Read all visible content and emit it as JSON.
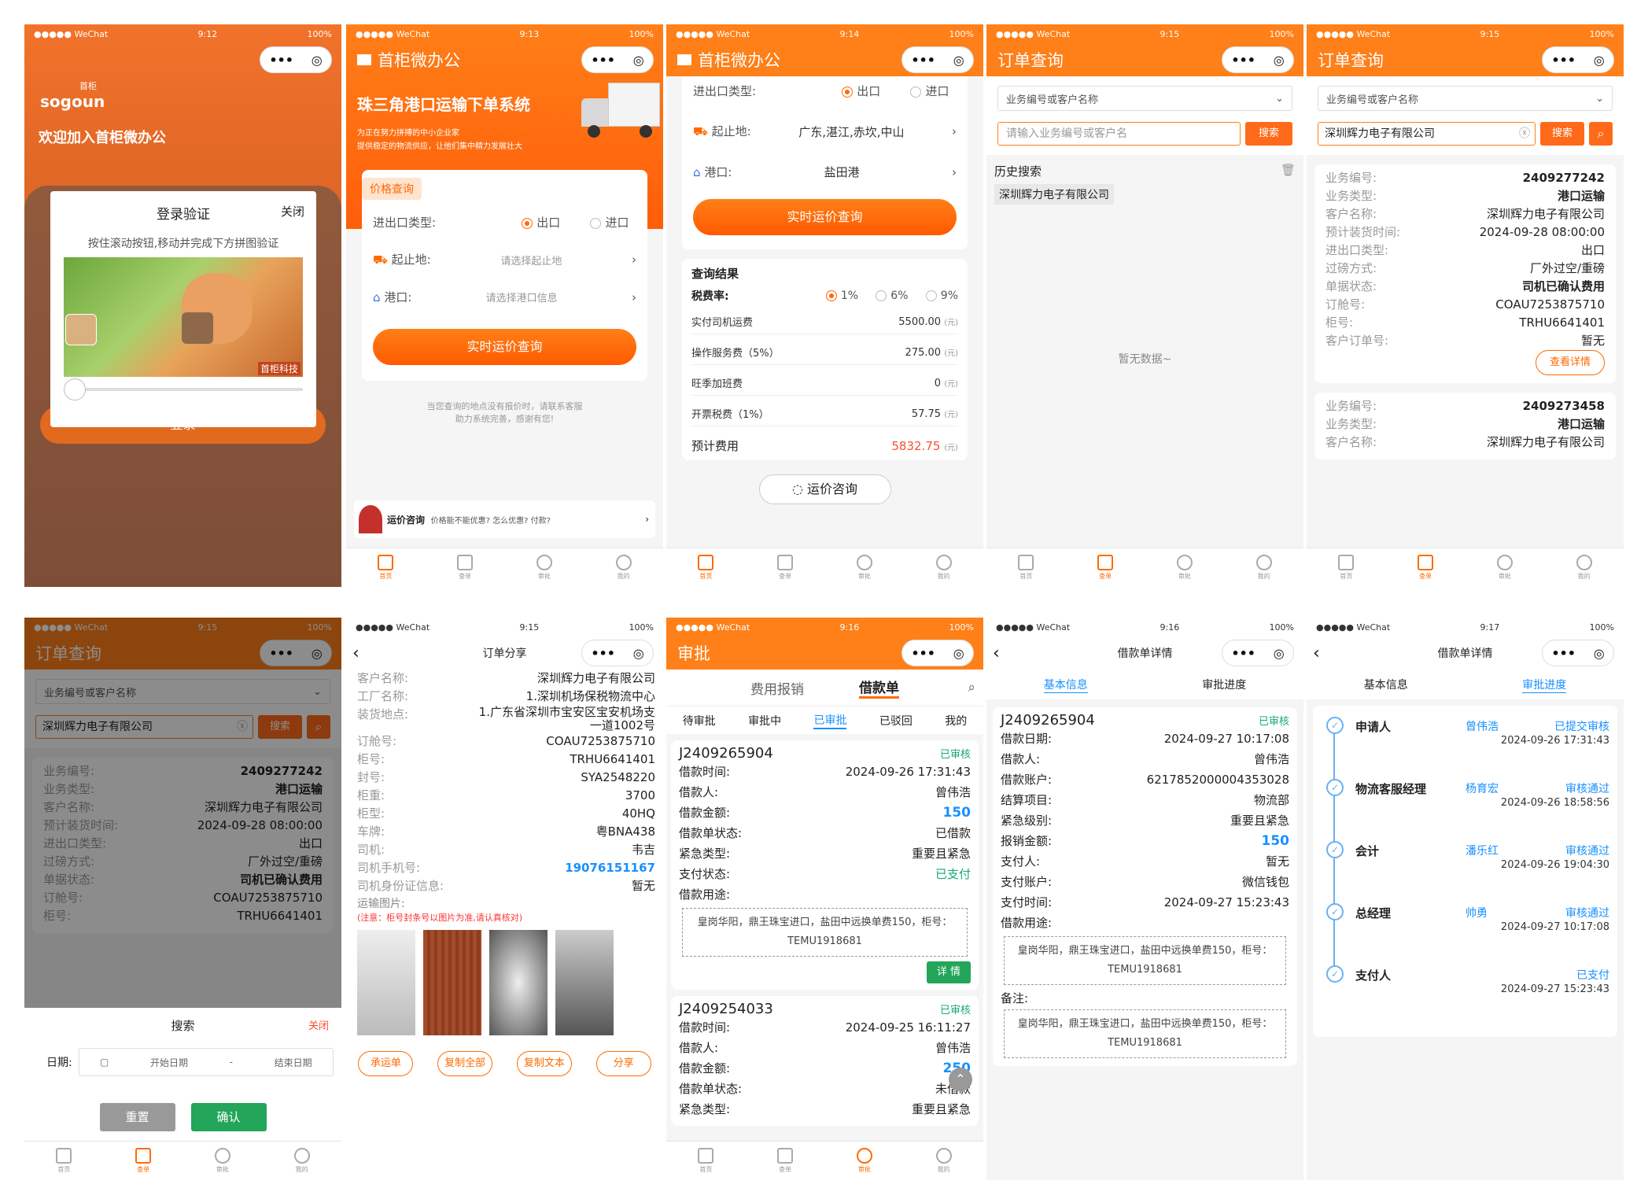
{
  "status": {
    "carrier": "●●●●● WeChat",
    "battery": "100%"
  },
  "times": [
    "9:12",
    "9:13",
    "9:14",
    "9:15",
    "9:15",
    "9:15",
    "9:15",
    "9:16",
    "9:16",
    "9:17"
  ],
  "capsule": {
    "more": "•••",
    "close": "◎"
  },
  "tabs": [
    "首页",
    "查单",
    "审批",
    "我的"
  ],
  "s1": {
    "logo": "sogoun",
    "logo_cn": "首柜",
    "welcome": "欢迎加入首柜微办公",
    "dlg_title": "登录验证",
    "dlg_close": "关闭",
    "dlg_hint": "按住滚动按钮,移动并完成下方拼图验证",
    "watermark": "首柜科技",
    "login": "登录"
  },
  "s2": {
    "title": "首柜微办公",
    "banner": "珠三角港口运输下单系统",
    "sub1": "为正在努力拼搏的中小企业家",
    "sub2": "提供稳定的物流供应，让他们集中精力发展壮大",
    "tab": "价格查询",
    "type_label": "进出口类型:",
    "export": "出口",
    "import": "进口",
    "origin_label": "起止地:",
    "origin_ph": "请选择起止地",
    "port_label": "港口:",
    "port_ph": "请选择港口信息",
    "btn": "实时运价查询",
    "note1": "当您查询的地点没有报价时，请联系客服",
    "note2": "助力系统完善，感谢有您!",
    "consult": "运价咨询",
    "consult_sub": "价格能不能优惠? 怎么优惠? 付款?"
  },
  "s3": {
    "title": "首柜微办公",
    "type_label": "进出口类型:",
    "export": "出口",
    "import": "进口",
    "origin_label": "起止地:",
    "origin": "广东,湛江,赤坎,中山",
    "port_label": "港口:",
    "port": "盐田港",
    "btn": "实时运价查询",
    "result": "查询结果",
    "tax": "税费率:",
    "r1": "1%",
    "r2": "6%",
    "r3": "9%",
    "items": [
      {
        "k": "实付司机运费",
        "v": "5500.00"
      },
      {
        "k": "操作服务费（5%）",
        "v": "275.00"
      },
      {
        "k": "旺季加班费",
        "v": "0"
      },
      {
        "k": "开票税费（1%）",
        "v": "57.75"
      }
    ],
    "unit": "(元)",
    "total_label": "预计费用",
    "total": "5832.75",
    "consult": "运价咨询"
  },
  "s4": {
    "title": "订单查询",
    "select": "业务编号或客户名称",
    "search_ph": "请输入业务编号或客户名",
    "search": "搜索",
    "history": "历史搜索",
    "history_item": "深圳辉力电子有限公司",
    "empty": "暂无数据~"
  },
  "s5": {
    "title": "订单查询",
    "select": "业务编号或客户名称",
    "search_val": "深圳辉力电子有限公司",
    "search": "搜索",
    "rows": [
      {
        "k": "业务编号:",
        "v": "2409277242"
      },
      {
        "k": "业务类型:",
        "v": "港口运输"
      },
      {
        "k": "客户名称:",
        "v": "深圳辉力电子有限公司"
      },
      {
        "k": "预计装货时间:",
        "v": "2024-09-28 08:00:00"
      },
      {
        "k": "进出口类型:",
        "v": "出口"
      },
      {
        "k": "过磅方式:",
        "v": "厂外过空/重磅"
      },
      {
        "k": "单据状态:",
        "v": "司机已确认费用"
      },
      {
        "k": "订舱号:",
        "v": "COAU7253875710"
      },
      {
        "k": "柜号:",
        "v": "TRHU6641401"
      },
      {
        "k": "客户订单号:",
        "v": "暂无"
      }
    ],
    "detail": "查看详情",
    "rows2": [
      {
        "k": "业务编号:",
        "v": "2409273458"
      },
      {
        "k": "业务类型:",
        "v": "港口运输"
      },
      {
        "k": "客户名称:",
        "v": "深圳辉力电子有限公司"
      }
    ]
  },
  "s6": {
    "title": "订单查询",
    "sheet_title": "搜索",
    "sheet_close": "关闭",
    "date_label": "日期:",
    "start": "开始日期",
    "dash": "-",
    "end": "结束日期",
    "reset": "重置",
    "confirm": "确认"
  },
  "s7": {
    "title": "订单分享",
    "rows": [
      {
        "k": "客户名称:",
        "v": "深圳辉力电子有限公司"
      },
      {
        "k": "工厂名称:",
        "v": "1.深圳机场保税物流中心"
      },
      {
        "k": "装货地点:",
        "v": "1.广东省深圳市宝安区宝安机场支一道1002号"
      },
      {
        "k": "订舱号:",
        "v": "COAU7253875710"
      },
      {
        "k": "柜号:",
        "v": "TRHU6641401"
      },
      {
        "k": "封号:",
        "v": "SYA2548220"
      },
      {
        "k": "柜重:",
        "v": "3700"
      },
      {
        "k": "柜型:",
        "v": "40HQ"
      },
      {
        "k": "车牌:",
        "v": "粤BNA438"
      },
      {
        "k": "司机:",
        "v": "韦吉"
      },
      {
        "k": "司机手机号:",
        "v": "19076151167"
      },
      {
        "k": "司机身份证信息:",
        "v": "暂无"
      }
    ],
    "photos": "运输图片:",
    "warn": "(注意：柜号封条号以图片为准,请认真核对)",
    "b1": "承运单",
    "b2": "复制全部",
    "b3": "复制文本",
    "b4": "分享"
  },
  "s8": {
    "title": "审批",
    "t1": "费用报销",
    "t2": "借款单",
    "sub": [
      "待审批",
      "审批中",
      "已审批",
      "已驳回",
      "我的"
    ],
    "card1": {
      "no": "J2409265904",
      "state": "已审核",
      "rows": [
        {
          "k": "借款时间:",
          "v": "2024-09-26 17:31:43"
        },
        {
          "k": "借款人:",
          "v": "曾伟浩"
        },
        {
          "k": "借款金额:",
          "v": "150"
        },
        {
          "k": "借款单状态:",
          "v": "已借款"
        },
        {
          "k": "紧急类型:",
          "v": "重要且紧急"
        },
        {
          "k": "支付状态:",
          "v": "已支付"
        },
        {
          "k": "借款用途:",
          "v": ""
        }
      ],
      "memo": "皇岗华阳，鼎王珠宝进口，盐田中远换单费150，柜号：TEMU1918681",
      "detail": "详 情"
    },
    "card2": {
      "no": "J2409254033",
      "state": "已审核",
      "rows": [
        {
          "k": "借款时间:",
          "v": "2024-09-25 16:11:27"
        },
        {
          "k": "借款人:",
          "v": "曾伟浩"
        },
        {
          "k": "借款金额:",
          "v": "250"
        },
        {
          "k": "借款单状态:",
          "v": "未借款"
        },
        {
          "k": "紧急类型:",
          "v": "重要且紧急"
        }
      ]
    }
  },
  "s9": {
    "title": "借款单详情",
    "t1": "基本信息",
    "t2": "审批进度",
    "no": "J2409265904",
    "state": "已审核",
    "rows": [
      {
        "k": "借款日期:",
        "v": "2024-09-27 10:17:08"
      },
      {
        "k": "借款人:",
        "v": "曾伟浩"
      },
      {
        "k": "借款账户:",
        "v": "6217852000004353028"
      },
      {
        "k": "结算项目:",
        "v": "物流部"
      },
      {
        "k": "紧急级别:",
        "v": "重要且紧急"
      },
      {
        "k": "报销金额:",
        "v": "150"
      },
      {
        "k": "支付人:",
        "v": "暂无"
      },
      {
        "k": "支付账户:",
        "v": "微信钱包"
      },
      {
        "k": "支付时间:",
        "v": "2024-09-27 15:23:43"
      },
      {
        "k": "借款用途:",
        "v": ""
      }
    ],
    "memo": "皇岗华阳，鼎王珠宝进口，盐田中远换单费150，柜号：TEMU1918681",
    "remark": "备注:"
  },
  "s10": {
    "title": "借款单详情",
    "t1": "基本信息",
    "t2": "审批进度",
    "steps": [
      {
        "role": "申请人",
        "name": "曾伟浩",
        "st": "已提交审核",
        "time": "2024-09-26 17:31:43"
      },
      {
        "role": "物流客服经理",
        "name": "杨育宏",
        "st": "审核通过",
        "time": "2024-09-26 18:58:56"
      },
      {
        "role": "会计",
        "name": "潘乐红",
        "st": "审核通过",
        "time": "2024-09-26 19:04:30"
      },
      {
        "role": "总经理",
        "name": "帅勇",
        "st": "审核通过",
        "time": "2024-09-27 10:17:08"
      },
      {
        "role": "支付人",
        "name": "",
        "st": "已支付",
        "time": "2024-09-27 15:23:43"
      }
    ]
  }
}
